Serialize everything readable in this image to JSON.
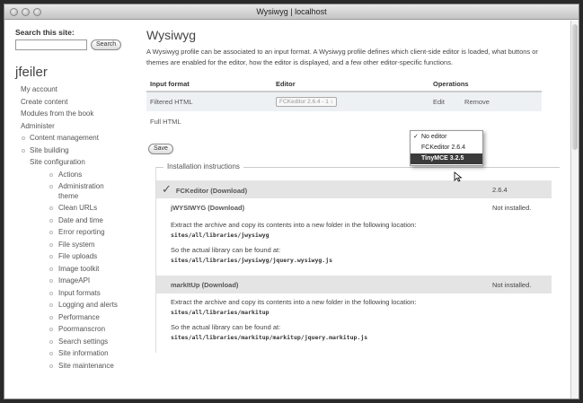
{
  "window": {
    "title": "Wysiwyg | localhost"
  },
  "sidebar": {
    "search_label": "Search this site:",
    "search_placeholder": "",
    "search_button": "Search",
    "username": "jfeiler",
    "items": [
      {
        "label": "My account"
      },
      {
        "label": "Create content"
      },
      {
        "label": "Modules from the book"
      },
      {
        "label": "Administer"
      },
      {
        "label": "Content management"
      },
      {
        "label": "Site building"
      },
      {
        "label": "Site configuration"
      },
      {
        "label": "Actions"
      },
      {
        "label": "Administration theme"
      },
      {
        "label": "Clean URLs"
      },
      {
        "label": "Date and time"
      },
      {
        "label": "Error reporting"
      },
      {
        "label": "File system"
      },
      {
        "label": "File uploads"
      },
      {
        "label": "Image toolkit"
      },
      {
        "label": "ImageAPI"
      },
      {
        "label": "Input formats"
      },
      {
        "label": "Logging and alerts"
      },
      {
        "label": "Performance"
      },
      {
        "label": "Poormanscron"
      },
      {
        "label": "Search settings"
      },
      {
        "label": "Site information"
      },
      {
        "label": "Site maintenance"
      }
    ]
  },
  "main": {
    "title": "Wysiwyg",
    "description": "A Wysiwyg profile can be associated to an input format. A Wysiwyg profile defines which client-side editor is loaded, what buttons or themes are enabled for the editor, how the editor is displayed, and a few other editor-specific functions.",
    "table": {
      "headers": [
        "Input format",
        "Editor",
        "Operations"
      ],
      "rows": [
        {
          "format": "Filtered HTML",
          "editor": "FCKeditor 2.6.4 - 1",
          "edit": "Edit",
          "remove": "Remove"
        },
        {
          "format": "Full HTML",
          "editor": "",
          "edit": "",
          "remove": ""
        }
      ]
    },
    "dropdown": {
      "options": [
        "No editor",
        "FCKeditor 2.6.4",
        "TinyMCE 3.2.5"
      ],
      "checked_index": 0,
      "highlighted_index": 2
    },
    "save_button": "Save",
    "install_legend": "Installation instructions",
    "libraries": [
      {
        "name": "FCKeditor",
        "download": "(Download)",
        "status": "2.6.4",
        "installed": true
      },
      {
        "name": "jWYSIWYG",
        "download": "(Download)",
        "status": "Not installed.",
        "installed": false,
        "extract_text": "Extract the archive and copy its contents into a new folder in the following location:",
        "extract_path": "sites/all/libraries/jwysiwyg",
        "found_text": "So the actual library can be found at:",
        "found_path": "sites/all/libraries/jwysiwyg/jquery.wysiwyg.js"
      },
      {
        "name": "markItUp",
        "download": "(Download)",
        "status": "Not installed.",
        "installed": false,
        "extract_text": "Extract the archive and copy its contents into a new folder in the following location:",
        "extract_path": "sites/all/libraries/markitup",
        "found_text": "So the actual library can be found at:",
        "found_path": "sites/all/libraries/markitup/markitup/jquery.markitup.js"
      }
    ]
  }
}
